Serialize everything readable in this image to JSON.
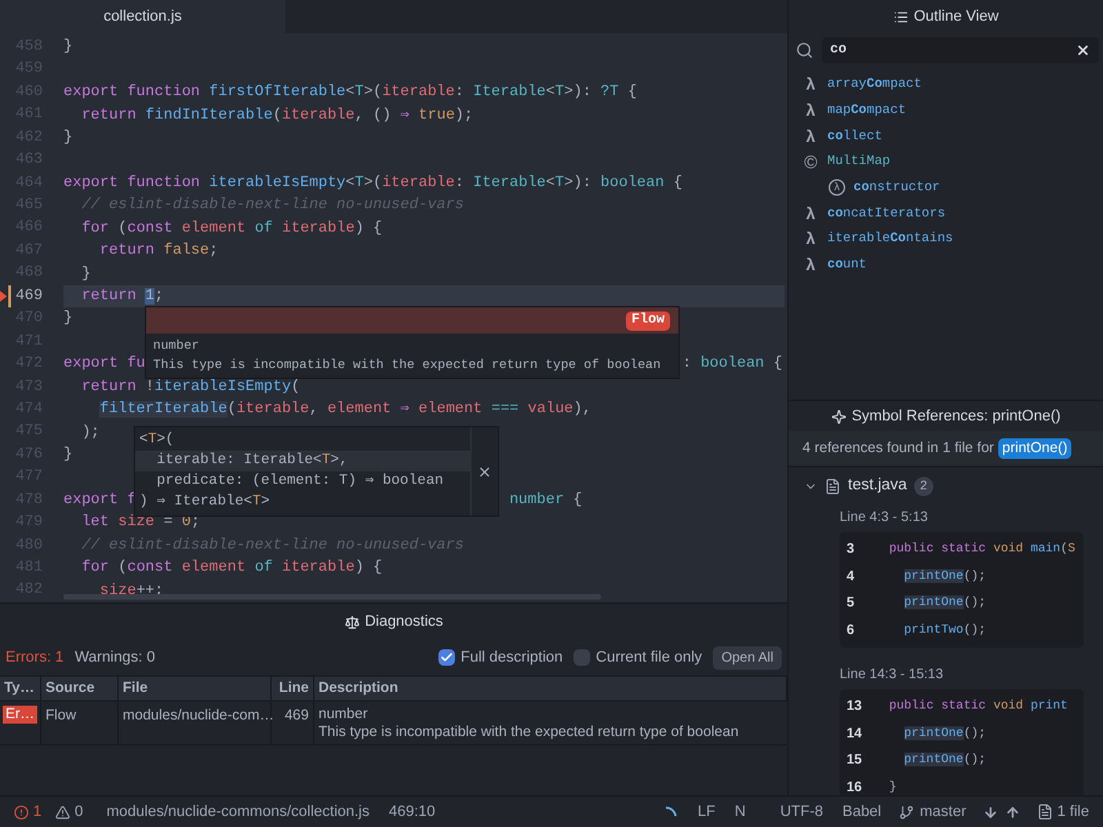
{
  "tabs": [
    {
      "label": "collection.js",
      "selected": true
    }
  ],
  "editor": {
    "lines": [
      {
        "number": "458",
        "cursor": false,
        "error": false,
        "tokens": [
          {
            "text": "}",
            "kind": "plain"
          }
        ]
      },
      {
        "number": "459",
        "cursor": false,
        "error": false
      },
      {
        "number": "460",
        "cursor": false,
        "error": false,
        "tokens": [
          {
            "text": "export function ",
            "kind": "keyword"
          },
          {
            "text": "firstOfIterable",
            "kind": "function"
          },
          {
            "text": "<",
            "kind": "plain"
          },
          {
            "text": "T",
            "kind": "type"
          },
          {
            "text": ">(",
            "kind": "plain"
          },
          {
            "text": "iterable",
            "kind": "variable"
          },
          {
            "text": ": ",
            "kind": "plain"
          },
          {
            "text": "Iterable",
            "kind": "type"
          },
          {
            "text": "<",
            "kind": "plain"
          },
          {
            "text": "T",
            "kind": "type"
          },
          {
            "text": ">): ",
            "kind": "plain"
          },
          {
            "text": "?T",
            "kind": "type"
          },
          {
            "text": " {",
            "kind": "plain"
          }
        ]
      },
      {
        "number": "461",
        "cursor": false,
        "error": false,
        "tokens": [
          {
            "text": "  return ",
            "kind": "keyword"
          },
          {
            "text": "findInIterable",
            "kind": "function"
          },
          {
            "text": "(",
            "kind": "plain"
          },
          {
            "text": "iterable",
            "kind": "variable"
          },
          {
            "text": ", () ",
            "kind": "plain"
          },
          {
            "text": "⇒",
            "kind": "keyword"
          },
          {
            "text": " true",
            "kind": "literal"
          },
          {
            "text": ");",
            "kind": "plain"
          }
        ]
      },
      {
        "number": "462",
        "cursor": false,
        "error": false,
        "tokens": [
          {
            "text": "}",
            "kind": "plain"
          }
        ]
      },
      {
        "number": "463",
        "cursor": false,
        "error": false
      },
      {
        "number": "464",
        "cursor": false,
        "error": false,
        "tokens": [
          {
            "text": "export function ",
            "kind": "keyword"
          },
          {
            "text": "iterableIsEmpty",
            "kind": "function"
          },
          {
            "text": "<",
            "kind": "plain"
          },
          {
            "text": "T",
            "kind": "type"
          },
          {
            "text": ">(",
            "kind": "plain"
          },
          {
            "text": "iterable",
            "kind": "variable"
          },
          {
            "text": ": ",
            "kind": "plain"
          },
          {
            "text": "Iterable",
            "kind": "type"
          },
          {
            "text": "<",
            "kind": "plain"
          },
          {
            "text": "T",
            "kind": "type"
          },
          {
            "text": ">): ",
            "kind": "plain"
          },
          {
            "text": "boolean",
            "kind": "type"
          },
          {
            "text": " {",
            "kind": "plain"
          }
        ]
      },
      {
        "number": "465",
        "cursor": false,
        "error": false,
        "tokens": [
          {
            "text": "  // eslint-disable-next-line no-unused-vars",
            "kind": "comment"
          }
        ]
      },
      {
        "number": "466",
        "cursor": false,
        "error": false,
        "tokens": [
          {
            "text": "  for",
            "kind": "keyword"
          },
          {
            "text": " (",
            "kind": "plain"
          },
          {
            "text": "const",
            "kind": "keyword"
          },
          {
            "text": " element",
            "kind": "variable"
          },
          {
            "text": " of",
            "kind": "type"
          },
          {
            "text": " iterable",
            "kind": "variable"
          },
          {
            "text": ") {",
            "kind": "plain"
          }
        ]
      },
      {
        "number": "467",
        "cursor": false,
        "error": false,
        "tokens": [
          {
            "text": "    return ",
            "kind": "keyword"
          },
          {
            "text": "false",
            "kind": "literal"
          },
          {
            "text": ";",
            "kind": "plain"
          }
        ]
      },
      {
        "number": "468",
        "cursor": false,
        "error": false,
        "tokens": [
          {
            "text": "  }",
            "kind": "plain"
          }
        ]
      },
      {
        "number": "469",
        "cursor": true,
        "error": true,
        "tokens": [
          {
            "text": "  return ",
            "kind": "keyword"
          },
          {
            "text": "1",
            "kind": "selection"
          },
          {
            "text": ";",
            "kind": "plain"
          }
        ]
      },
      {
        "number": "470",
        "cursor": false,
        "error": false,
        "tokens": [
          {
            "text": "}",
            "kind": "plain"
          }
        ]
      },
      {
        "number": "471",
        "cursor": false,
        "error": false
      },
      {
        "number": "472",
        "cursor": false,
        "error": false,
        "tokens": [
          {
            "text": "export fu",
            "kind": "keyword"
          }
        ],
        "tail": [
          {
            "text": ": ",
            "kind": "plain"
          },
          {
            "text": "boolean",
            "kind": "type"
          },
          {
            "text": " {",
            "kind": "plain"
          }
        ]
      },
      {
        "number": "473",
        "cursor": false,
        "error": false,
        "tokens": [
          {
            "text": "  return ",
            "kind": "keyword"
          },
          {
            "text": "!",
            "kind": "plain"
          },
          {
            "text": "iterableIsEmpty",
            "kind": "function"
          },
          {
            "text": "(",
            "kind": "plain"
          }
        ]
      },
      {
        "number": "474",
        "cursor": false,
        "error": false,
        "tokens": [
          {
            "text": "    filterIterable",
            "kind": "reference"
          },
          {
            "text": "(",
            "kind": "plain"
          },
          {
            "text": "iterable",
            "kind": "variable"
          },
          {
            "text": ", ",
            "kind": "plain"
          },
          {
            "text": "element",
            "kind": "variable"
          },
          {
            "text": " ⇒",
            "kind": "keyword"
          },
          {
            "text": " element",
            "kind": "variable"
          },
          {
            "text": " ===",
            "kind": "type"
          },
          {
            "text": " value",
            "kind": "variable"
          },
          {
            "text": "),",
            "kind": "plain"
          }
        ]
      },
      {
        "number": "475",
        "cursor": false,
        "error": false,
        "tokens": [
          {
            "text": "  );",
            "kind": "plain"
          }
        ]
      },
      {
        "number": "476",
        "cursor": false,
        "error": false,
        "tokens": [
          {
            "text": "}",
            "kind": "plain"
          }
        ]
      },
      {
        "number": "477",
        "cursor": false,
        "error": false
      },
      {
        "number": "478",
        "cursor": false,
        "error": false,
        "tokens": [
          {
            "text": "export f",
            "kind": "keyword"
          }
        ],
        "tail": [
          {
            "text": "number",
            "kind": "type"
          },
          {
            "text": " {",
            "kind": "plain"
          }
        ]
      },
      {
        "number": "479",
        "cursor": false,
        "error": false,
        "tokens": [
          {
            "text": "  let ",
            "kind": "keyword"
          },
          {
            "text": "size",
            "kind": "variable"
          },
          {
            "text": " = ",
            "kind": "plain"
          },
          {
            "text": "0",
            "kind": "literal"
          },
          {
            "text": ";",
            "kind": "plain"
          }
        ]
      },
      {
        "number": "480",
        "cursor": false,
        "error": false,
        "tokens": [
          {
            "text": "  // eslint-disable-next-line no-unused-vars",
            "kind": "comment"
          }
        ]
      },
      {
        "number": "481",
        "cursor": false,
        "error": false,
        "tokens": [
          {
            "text": "  for",
            "kind": "keyword"
          },
          {
            "text": " (",
            "kind": "plain"
          },
          {
            "text": "const",
            "kind": "keyword"
          },
          {
            "text": " element",
            "kind": "variable"
          },
          {
            "text": " of",
            "kind": "type"
          },
          {
            "text": " iterable",
            "kind": "variable"
          },
          {
            "text": ") {",
            "kind": "plain"
          }
        ]
      },
      {
        "number": "482",
        "cursor": false,
        "error": false,
        "tokens": [
          {
            "text": "    size",
            "kind": "variable"
          },
          {
            "text": "++;",
            "kind": "plain"
          }
        ]
      }
    ]
  },
  "error_tooltip": {
    "source": "Flow",
    "type": "number",
    "message": "This type is incompatible with the expected return type of boolean"
  },
  "signature_help": {
    "lines": [
      {
        "selected": false,
        "tokens": [
          {
            "text": "<",
            "kind": "plain"
          },
          {
            "text": "T",
            "kind": "literal"
          },
          {
            "text": ">(",
            "kind": "plain"
          }
        ]
      },
      {
        "selected": true,
        "tokens": [
          {
            "text": "  iterable: Iterable<",
            "kind": "plain"
          },
          {
            "text": "T",
            "kind": "literal"
          },
          {
            "text": ">,",
            "kind": "plain"
          }
        ]
      },
      {
        "selected": false,
        "tokens": [
          {
            "text": "  predicate: (element: T) ⇒ boolean",
            "kind": "plain"
          }
        ]
      },
      {
        "selected": false,
        "tokens": [
          {
            "text": ") ⇒ Iterable<",
            "kind": "plain"
          },
          {
            "text": "T",
            "kind": "literal"
          },
          {
            "text": ">",
            "kind": "plain"
          }
        ]
      }
    ]
  },
  "diagnostics": {
    "title": "Diagnostics",
    "errors": "Errors: 1",
    "warnings": "Warnings: 0",
    "options": [
      {
        "label": "Full description",
        "checked": true
      },
      {
        "label": "Current file only",
        "checked": false
      }
    ],
    "open_all": "Open All",
    "columns": [
      "Ty…",
      "Source",
      "File",
      "Line",
      "Description"
    ],
    "rows": [
      {
        "type": "Er…",
        "source": "Flow",
        "file": "modules/nuclide-com…",
        "line": "469",
        "description": "number",
        "detail": "This type is incompatible with the expected return type of boolean"
      }
    ]
  },
  "outline": {
    "title": "Outline View",
    "search": "co",
    "items": [
      {
        "kind": "function",
        "icon": "λ",
        "name": "array**Co**mpact"
      },
      {
        "kind": "function",
        "icon": "λ",
        "name": "map**Co**mpact"
      },
      {
        "kind": "function",
        "icon": "λ",
        "name": "**co**llect"
      },
      {
        "kind": "class",
        "icon": "©",
        "name": "MultiMap",
        "children": [
          {
            "kind": "method",
            "icon": "λ",
            "name": "**co**nstructor"
          }
        ]
      },
      {
        "kind": "function",
        "icon": "λ",
        "name": "**co**ncatIterators"
      },
      {
        "kind": "function",
        "icon": "λ",
        "name": "iterable**Co**ntains"
      },
      {
        "kind": "function",
        "icon": "λ",
        "name": "**co**unt"
      }
    ]
  },
  "references": {
    "title": "Symbol References: printOne()",
    "summary": "4 references found in 1 file for",
    "symbol": "printOne()",
    "files": [
      {
        "name": "test.java",
        "count": "2",
        "expanded": true,
        "groups": [
          {
            "range": "Line 4:3 - 5:13",
            "lines": [
              {
                "number": "3",
                "tokens": [
                  {
                    "text": "  public static ",
                    "kind": "keyword"
                  },
                  {
                    "text": "void ",
                    "kind": "literal"
                  },
                  {
                    "text": "main",
                    "kind": "function"
                  },
                  {
                    "text": "(",
                    "kind": "plain"
                  },
                  {
                    "text": "S",
                    "kind": "literal"
                  }
                ]
              },
              {
                "number": "4",
                "tokens": [
                  {
                    "text": "    printOne",
                    "kind": "match"
                  },
                  {
                    "text": "();",
                    "kind": "plain"
                  }
                ]
              },
              {
                "number": "5",
                "tokens": [
                  {
                    "text": "    printOne",
                    "kind": "match"
                  },
                  {
                    "text": "();",
                    "kind": "plain"
                  }
                ]
              },
              {
                "number": "6",
                "tokens": [
                  {
                    "text": "    printTwo",
                    "kind": "function"
                  },
                  {
                    "text": "();",
                    "kind": "plain"
                  }
                ]
              }
            ]
          },
          {
            "range": "Line 14:3 - 15:13",
            "lines": [
              {
                "number": "13",
                "tokens": [
                  {
                    "text": "  public static ",
                    "kind": "keyword"
                  },
                  {
                    "text": "void ",
                    "kind": "literal"
                  },
                  {
                    "text": "print",
                    "kind": "function"
                  }
                ]
              },
              {
                "number": "14",
                "tokens": [
                  {
                    "text": "    printOne",
                    "kind": "match"
                  },
                  {
                    "text": "();",
                    "kind": "plain"
                  }
                ]
              },
              {
                "number": "15",
                "tokens": [
                  {
                    "text": "    printOne",
                    "kind": "match"
                  },
                  {
                    "text": "();",
                    "kind": "plain"
                  }
                ]
              },
              {
                "number": "16",
                "tokens": [
                  {
                    "text": "  }",
                    "kind": "plain"
                  }
                ]
              }
            ]
          }
        ]
      }
    ]
  },
  "status_bar": {
    "errors": "1",
    "warnings": "0",
    "path": "modules/nuclide-commons/collection.js",
    "position": "469:10",
    "line_ending": "LF",
    "mode": "N",
    "encoding": "UTF-8",
    "grammar": "Babel",
    "branch": "master",
    "files": "1 file"
  }
}
